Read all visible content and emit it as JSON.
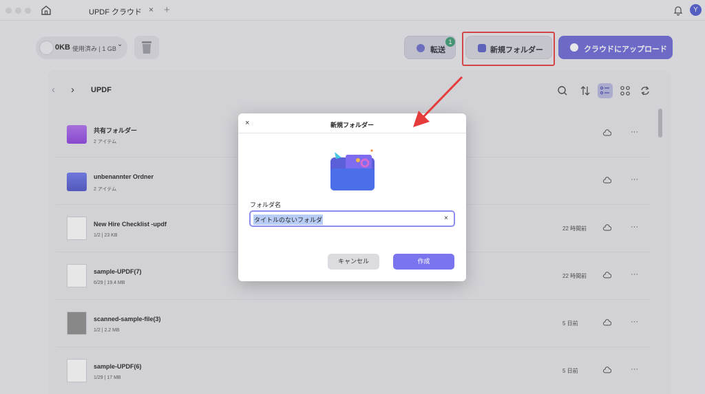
{
  "titlebar": {
    "tab_title": "UPDF クラウド",
    "tab_close": "×",
    "tab_add": "+",
    "avatar_initial": "Y"
  },
  "toolbar": {
    "storage_used_strong": "0KB",
    "storage_used_rest": "使用済み | 1 GB",
    "storage_chevron": "⌄",
    "transfer_label": "転送",
    "transfer_badge": "1",
    "new_folder_label": "新規フォルダー",
    "upload_label": "クラウドにアップロード"
  },
  "nav": {
    "back": "‹",
    "forward": "›",
    "breadcrumb": "UPDF"
  },
  "files": [
    {
      "name": "共有フォルダー",
      "meta": "2 アイテム",
      "time": "",
      "kind": "folder-purple"
    },
    {
      "name": "unbenannter Ordner",
      "meta": "2 アイテム",
      "time": "",
      "kind": "folder-blue"
    },
    {
      "name": "New Hire Checklist -updf",
      "meta": "1/2 | 23 KB",
      "time": "22 時間前",
      "kind": "doc"
    },
    {
      "name": "sample-UPDF(7)",
      "meta": "6/29 | 19.4 MB",
      "time": "22 時間前",
      "kind": "doc"
    },
    {
      "name": "scanned-sample-file(3)",
      "meta": "1/2 | 2.2 MB",
      "time": "5 日前",
      "kind": "doc-dark"
    },
    {
      "name": "sample-UPDF(6)",
      "meta": "1/29 | 17 MB",
      "time": "5 日前",
      "kind": "doc"
    }
  ],
  "dialog": {
    "title": "新規フォルダー",
    "close": "×",
    "field_label": "フォルダ名",
    "field_value": "タイトルのないフォルダ",
    "clear": "×",
    "cancel": "キャンセル",
    "create": "作成"
  },
  "colors": {
    "accent": "#6b66d6",
    "highlight": "#e63b3b",
    "badge": "#3a9c72"
  }
}
